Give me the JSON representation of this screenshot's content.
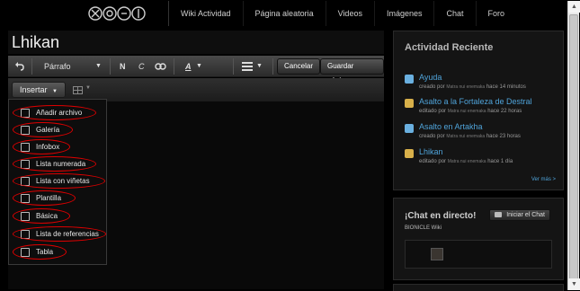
{
  "nav": {
    "links": [
      "Wiki Actividad",
      "Página aleatoria",
      "Videos",
      "Imágenes",
      "Chat",
      "Foro"
    ]
  },
  "editor": {
    "title": "Lhikan",
    "toolbar": {
      "undo_icon": "undo-icon",
      "format": "Párrafo",
      "bold": "N",
      "italic": "C",
      "link_icon": "link-icon",
      "text_style": "A",
      "list_icon": "list-icon",
      "cancel": "Cancelar",
      "save": "Guardar página"
    },
    "insert": "Insertar",
    "table_icon": "table-icon"
  },
  "insert_menu": {
    "items": [
      {
        "label": "Añadir archivo",
        "icon": "add-file-icon"
      },
      {
        "label": "Galería",
        "icon": "gallery-icon"
      },
      {
        "label": "Infobox",
        "icon": "infobox-icon"
      },
      {
        "label": "Lista numerada",
        "icon": "numbered-list-icon"
      },
      {
        "label": "Lista con viñetas",
        "icon": "bulleted-list-icon"
      },
      {
        "label": "Plantilla",
        "icon": "template-icon"
      },
      {
        "label": "Básica",
        "icon": "basic-icon"
      },
      {
        "label": "Lista de referencias",
        "icon": "references-icon"
      },
      {
        "label": "Tabla",
        "icon": "table-icon"
      }
    ],
    "annotation_color": "#dd0000"
  },
  "activity": {
    "heading": "Actividad Reciente",
    "items": [
      {
        "title": "Ayuda",
        "edited_by": "creado por",
        "user": "Matra nui enemaka",
        "time": "hace 14 minutos"
      },
      {
        "title": "Asalto a la Fortaleza de Destral",
        "edited_by": "editado por",
        "user": "Matra nui enemaka",
        "time": "hace 22 horas"
      },
      {
        "title": "Asalto en Artakha",
        "edited_by": "creado por",
        "user": "Matra nui enemaka",
        "time": "hace 23 horas"
      },
      {
        "title": "Lhikan",
        "edited_by": "editado por",
        "user": "Matra nui enemaka",
        "time": "hace 1 día"
      }
    ],
    "more": "Ver más >"
  },
  "chat": {
    "heading": "¡Chat en directo!",
    "start": "Iniciar el Chat",
    "wiki": "BIONICLE Wiki"
  },
  "colors": {
    "accent_link": "#4fa3d9",
    "background": "#0b0b0b"
  }
}
